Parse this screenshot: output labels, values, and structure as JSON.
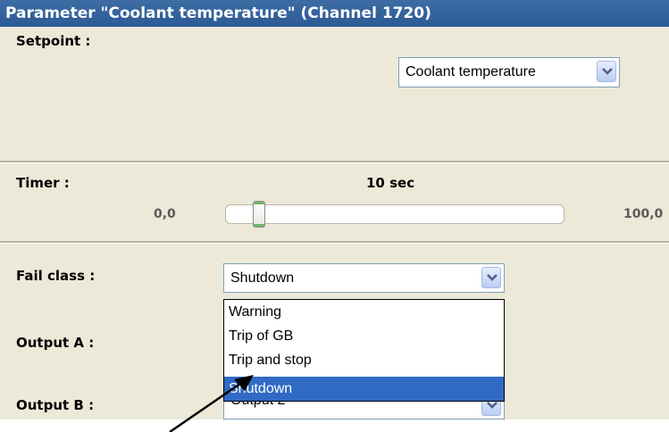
{
  "title": "Parameter \"Coolant temperature\" (Channel 1720)",
  "setpoint": {
    "label": "Setpoint :",
    "selected": "Coolant temperature"
  },
  "timer": {
    "label": "Timer :",
    "value_text": "10 sec",
    "min": "0,0",
    "max": "100,0",
    "value": 10
  },
  "fail_class": {
    "label": "Fail class :",
    "selected": "Shutdown",
    "options": [
      "Warning",
      "Trip of GB",
      "Trip and stop",
      "Shutdown"
    ],
    "highlighted": "Shutdown"
  },
  "output_a": {
    "label": "Output A :"
  },
  "output_b": {
    "label": "Output B :",
    "selected": "Output 2"
  },
  "colors": {
    "title_bar": "#2c5a95",
    "panel": "#ece9d8",
    "selection": "#316ac5"
  },
  "icons": [
    "chevron-down-icon",
    "arrow-pointer-icon"
  ]
}
